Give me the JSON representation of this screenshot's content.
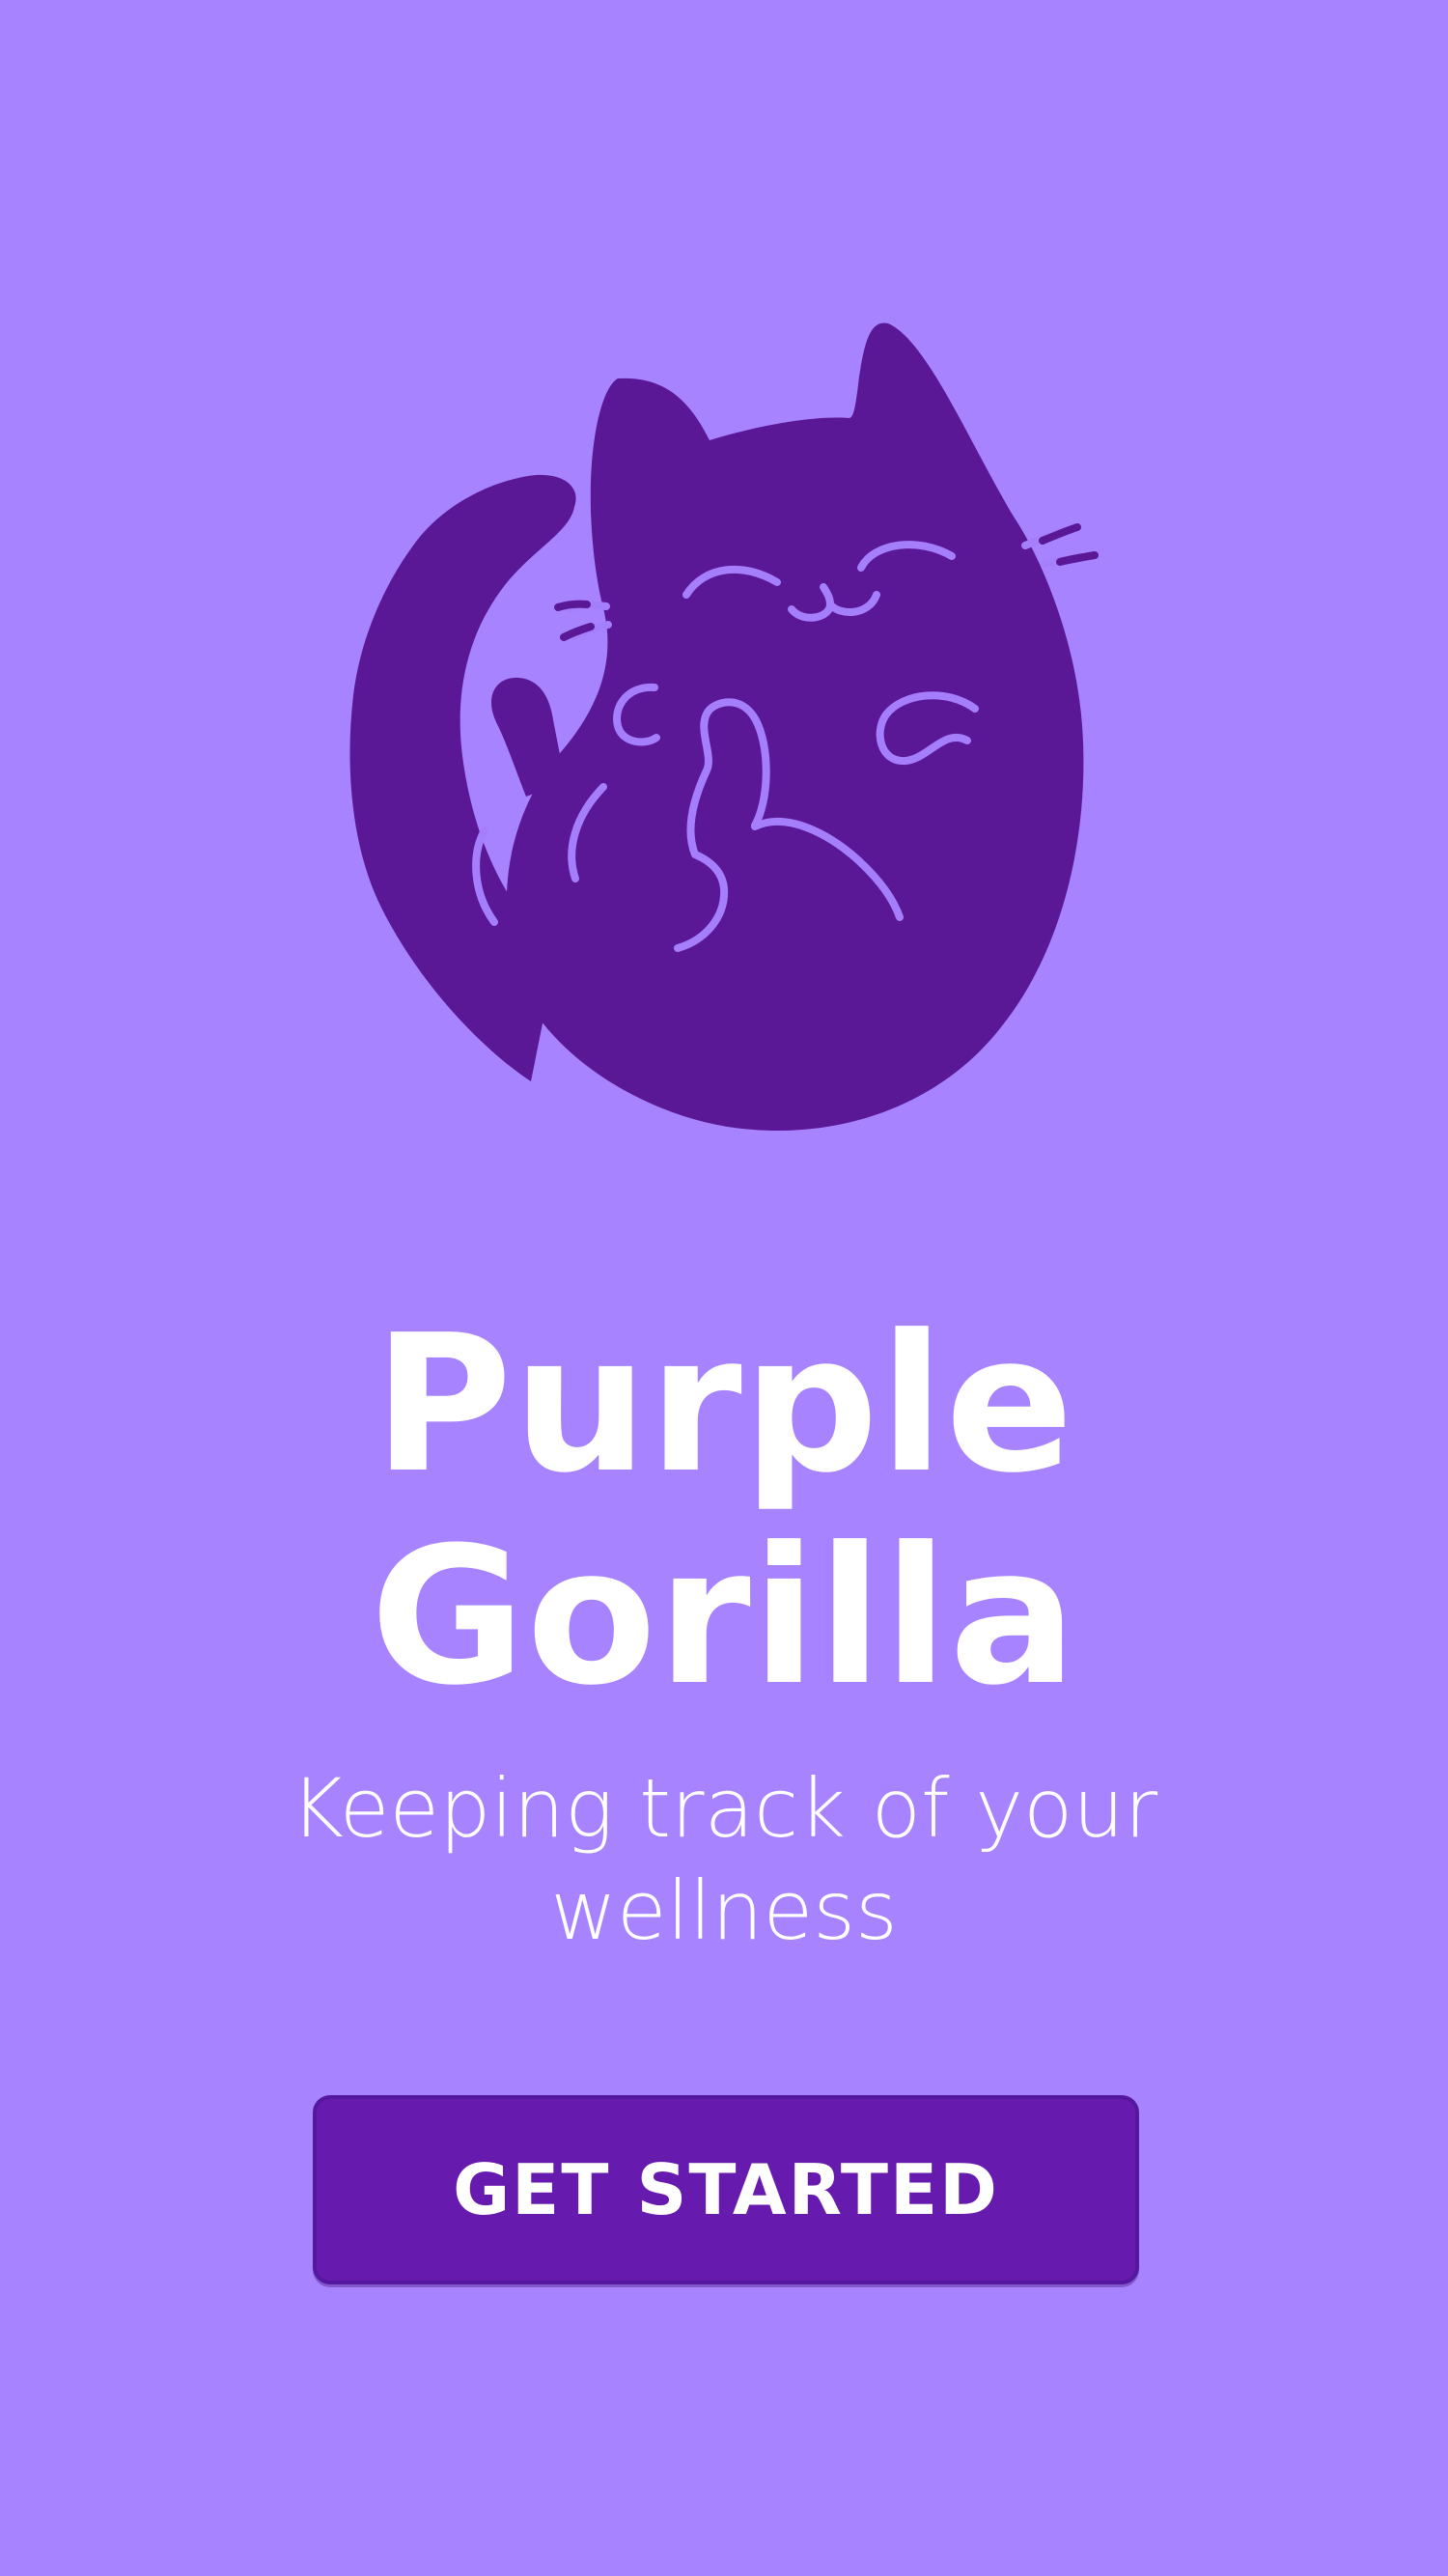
{
  "app": {
    "title": "Purple Gorilla",
    "tagline": "Keeping track of your wellness"
  },
  "actions": {
    "get_started_label": "GET STARTED"
  },
  "illustration": {
    "icon": "cat-mascot-icon"
  },
  "colors": {
    "background": "#A883FF",
    "mascot": "#5A1896",
    "mascot_lines": "#A57EFC",
    "button": "#661AAE",
    "text": "#FFFFFF"
  }
}
